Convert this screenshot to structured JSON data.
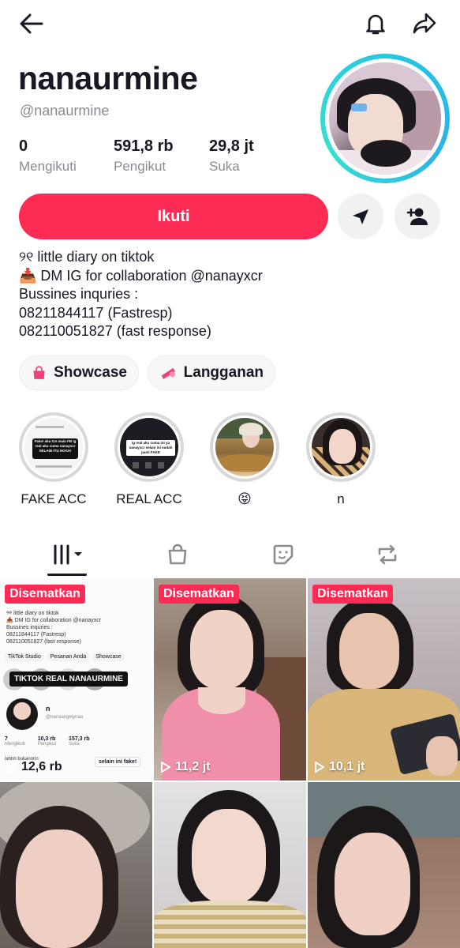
{
  "profile": {
    "display_name": "nanaurmine",
    "handle": "@nanaurmine",
    "stats": [
      {
        "value": "0",
        "label": "Mengikuti"
      },
      {
        "value": "591,8 rb",
        "label": "Pengikut"
      },
      {
        "value": "29,8 jt",
        "label": "Suka"
      }
    ],
    "follow_label": "Ikuti",
    "bio_lines": [
      "୨୧ little diary on tiktok",
      "📥 DM IG for collaboration @nanayxcr",
      "Bussines inquries :",
      "08211844117 (Fastresp)",
      "082110051827 (fast response)"
    ],
    "pills": [
      {
        "label": "Showcase",
        "icon": "shopping-bag-icon"
      },
      {
        "label": "Langganan",
        "icon": "subscription-icon"
      }
    ]
  },
  "highlights": [
    {
      "label": "FAKE ACC",
      "caption_text": "Fake! aku GA main FB ig real aku cuma nanayxcr SELAIN ITU HOAX!"
    },
    {
      "label": "REAL ACC",
      "caption_text": "ig real aku cuma ini ya nanayxcr selain ini sudah pasti FAKE"
    },
    {
      "label": "😝"
    },
    {
      "label": "n"
    }
  ],
  "tabs": [
    {
      "name": "videos-tab",
      "icon": "grid-bars-icon"
    },
    {
      "name": "shop-tab",
      "icon": "shopping-bag-icon"
    },
    {
      "name": "stickers-tab",
      "icon": "sticker-icon"
    },
    {
      "name": "reposts-tab",
      "icon": "repost-icon"
    }
  ],
  "videos": [
    {
      "pinned": "Disematkan",
      "views": "12,6 rb",
      "overlay_title": "TIKTOK REAL NANAURMINE",
      "note": "selain ini fake!"
    },
    {
      "pinned": "Disematkan",
      "views": "11,2 jt"
    },
    {
      "pinned": "Disematkan",
      "views": "10,1 jt"
    },
    {
      "views": ""
    },
    {
      "views": ""
    },
    {
      "views": ""
    }
  ],
  "video1_screenshot": {
    "bio_lines": [
      "୨୧ little diary on tiktok",
      "📥 DM IG for collaboration @nanayxcr",
      "Bussines inquries :",
      "08211844117 (Fastresp)",
      "082110051827 (fast response)"
    ],
    "chips": [
      "TikTok Studio",
      "Pesanan Anda",
      "Showcase"
    ],
    "sub_name": "n",
    "sub_handle": "@nanaangelynaa",
    "sub_stats": [
      {
        "v": "7",
        "l": "Mengikuti"
      },
      {
        "v": "10,3 rb",
        "l": "Pengikut"
      },
      {
        "v": "157,3 rb",
        "l": "Suka"
      }
    ],
    "caption": "lahhh bukannnn"
  },
  "colors": {
    "accent": "#fe2c55",
    "ring": "#25c8e0",
    "text": "#161823",
    "muted": "#8a8b91"
  }
}
